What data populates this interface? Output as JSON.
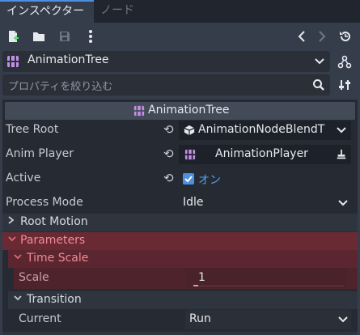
{
  "tabs": {
    "inspector": "インスペクター",
    "node": "ノード"
  },
  "object": {
    "name": "AnimationTree"
  },
  "filter": {
    "placeholder": "プロパティを絞り込む"
  },
  "header": {
    "title": "AnimationTree"
  },
  "properties": {
    "tree_root": {
      "label": "Tree Root",
      "value": "AnimationNodeBlendT"
    },
    "anim_player": {
      "label": "Anim Player",
      "value": "AnimationPlayer"
    },
    "active": {
      "label": "Active",
      "value": "オン",
      "checked": true
    },
    "process_mode": {
      "label": "Process Mode",
      "value": "Idle"
    }
  },
  "sections": {
    "root_motion": "Root Motion",
    "parameters": "Parameters",
    "time_scale": "Time Scale",
    "scale_label": "Scale",
    "scale_value": "1",
    "transition": "Transition",
    "current_label": "Current",
    "current_value": "Run"
  },
  "colors": {
    "accent": "#4d8fe0",
    "node_icon": "#c58fe8",
    "parameters_bg": "#6a2a34",
    "time_scale_bg": "#5b2630",
    "scale_bg": "#4f232b"
  },
  "icons": [
    "new-resource-icon",
    "load-resource-icon",
    "save-resource-icon",
    "more-options-icon",
    "history-back-icon",
    "history-forward-icon",
    "recent-history-icon",
    "animation-tree-node-icon",
    "node-selector-icon",
    "search-icon",
    "sort-properties-icon",
    "revert-icon",
    "resource-cube-icon",
    "animation-player-icon",
    "assign-node-icon",
    "checkbox-checked-icon"
  ]
}
